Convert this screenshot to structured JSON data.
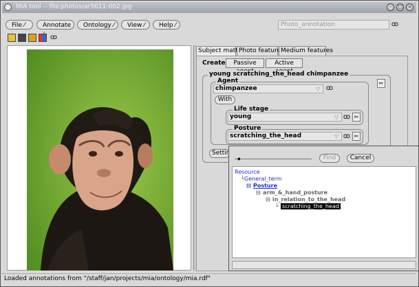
{
  "window": {
    "title": "MIA tool -- file:photos/ar5611-002.jpg"
  },
  "menu": {
    "file": "File",
    "annotate": "Annotate",
    "ontology": "Ontology",
    "view": "View",
    "help": "Help"
  },
  "toolbar": {
    "mode_combo": "Photo_annotation"
  },
  "tabs": {
    "subject_matter": "Subject matter",
    "photo_features": "Photo features",
    "medium_features": "Medium features"
  },
  "create": {
    "label": "Create:",
    "passive": "Passive agent",
    "active": "Active agent"
  },
  "annotation": {
    "title": "young scratching_the_head chimpanzee",
    "agent_label": "Agent",
    "agent_value": "chimpanzee",
    "with_button": "With",
    "life_stage_label": "Life stage",
    "life_stage_value": "young",
    "posture_label": "Posture",
    "posture_value": "scratching_the_head",
    "setting_button": "Settin"
  },
  "popup": {
    "find_button": "Find",
    "cancel_button": "Cancel",
    "tree": {
      "resource": "Resource",
      "general_term": "General_term",
      "posture": "Posture",
      "arm_hand_posture": "arm_&_hand_posture",
      "in_relation": "in_relation_to_the_head",
      "scratching": "scratching_the_head"
    }
  },
  "status": "Loaded annotations from \"/staff/jan/projects/mia/ontology/mia.rdf\""
}
